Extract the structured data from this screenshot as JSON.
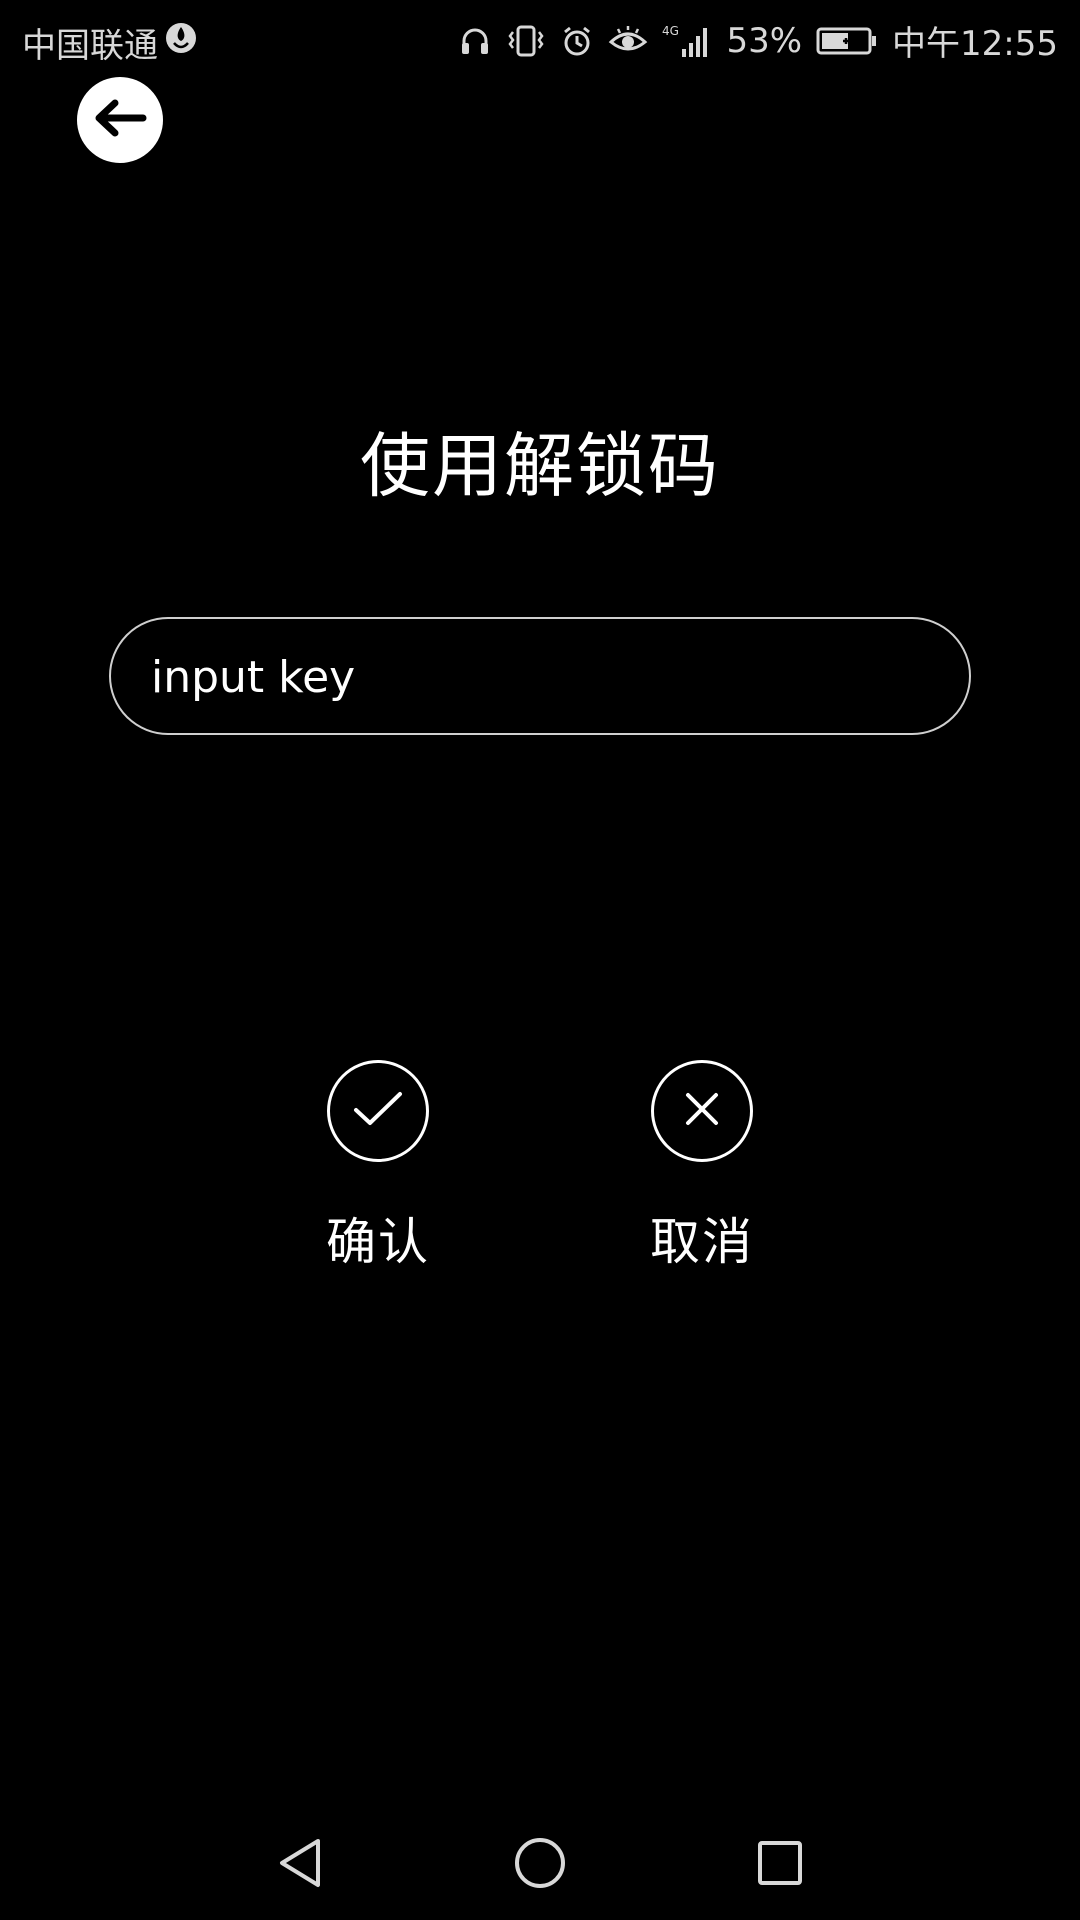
{
  "status_bar": {
    "carrier": "中国联通",
    "battery_percent": "53%",
    "time": "中午12:55",
    "network": "4G",
    "icons": [
      "hotspot-icon",
      "headphone-icon",
      "vibrate-icon",
      "alarm-icon",
      "eye-comfort-icon",
      "signal-icon",
      "battery-charging-icon"
    ]
  },
  "header": {
    "back_icon": "arrow-left-icon"
  },
  "main": {
    "title": "使用解锁码",
    "input": {
      "placeholder": "input key",
      "value": ""
    },
    "actions": [
      {
        "label": "确认",
        "icon": "check-icon"
      },
      {
        "label": "取消",
        "icon": "close-icon"
      }
    ]
  },
  "nav_bar": {
    "icons": [
      "nav-back-icon",
      "nav-home-icon",
      "nav-recent-icon"
    ]
  }
}
